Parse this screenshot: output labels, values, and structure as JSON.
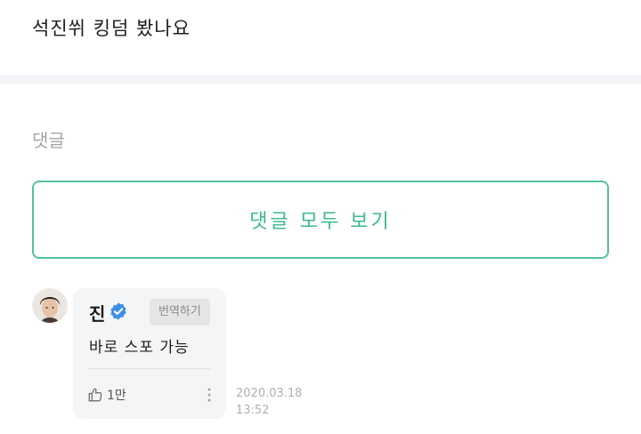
{
  "post": {
    "title": "석진쒸 킹덤 봤나요"
  },
  "comments": {
    "heading": "댓글",
    "view_all_label": "댓글 모두 보기",
    "accent_color": "#3cb893",
    "items": [
      {
        "author": "진",
        "verified": true,
        "translate_label": "번역하기",
        "text": "바로 스포 가능",
        "likes": "1만",
        "date": "2020.03.18",
        "time": "13:52"
      }
    ]
  },
  "icons": {
    "verified": "verified-badge-icon",
    "like": "thumbs-up-icon",
    "more": "more-vertical-icon"
  },
  "colors": {
    "verified_badge": "#3d8ee8",
    "divider_band": "#f3f5f8",
    "bubble_bg": "#f4f5f7"
  }
}
